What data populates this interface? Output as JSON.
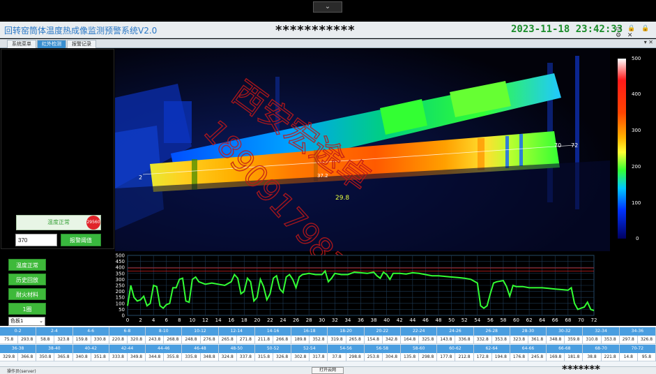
{
  "window": {
    "collapse_glyph": "⌄",
    "title": "回转窑筒体温度热成像监测预警系统V2.0",
    "masked_center": "***********",
    "clock": "2023-11-18 23:42:33",
    "window_icons": "▭ 🔒 🔒 ⚙ ✕"
  },
  "tabs": [
    {
      "label": "系统菜单",
      "active": false
    },
    {
      "label": "红外检测",
      "active": true
    },
    {
      "label": "报警记录",
      "active": false
    }
  ],
  "tab_pin": "▾ ✕",
  "status_panel": {
    "status_text": "温度正常",
    "alarm_badge": "29560",
    "threshold_value": "370",
    "threshold_button": "报警阈值"
  },
  "thermal": {
    "marker_start": "2",
    "marker_mid": "37.2",
    "marker_70": "70",
    "marker_72": "72",
    "spot_temp": "29.8",
    "watermark_name": "西安宏途卓",
    "watermark_phone": "18909179813"
  },
  "color_scale": {
    "labels": [
      "500",
      "400",
      "300",
      "200",
      "100",
      "0"
    ]
  },
  "side_buttons": [
    "温度正常",
    "历史回放",
    "耐火材料",
    "1圈"
  ],
  "palette_select": "色板1",
  "chart_data": {
    "type": "line",
    "ylabel": "温度",
    "ylim": [
      0,
      500
    ],
    "yticks": [
      0,
      50,
      100,
      150,
      200,
      250,
      300,
      350,
      400,
      450,
      500
    ],
    "xlim": [
      0,
      72
    ],
    "xticks": [
      0,
      2,
      4,
      6,
      8,
      10,
      12,
      14,
      16,
      18,
      20,
      22,
      24,
      26,
      28,
      30,
      32,
      34,
      36,
      38,
      40,
      42,
      44,
      46,
      48,
      50,
      52,
      54,
      56,
      58,
      60,
      62,
      64,
      66,
      68,
      70,
      72
    ],
    "threshold_lines": [
      395,
      370
    ],
    "series": [
      {
        "color": "#33ff33",
        "points": [
          [
            0,
            80
          ],
          [
            0.5,
            250
          ],
          [
            1,
            150
          ],
          [
            1.5,
            120
          ],
          [
            2,
            130
          ],
          [
            2.5,
            160
          ],
          [
            3,
            80
          ],
          [
            3.5,
            100
          ],
          [
            4,
            250
          ],
          [
            4.5,
            240
          ],
          [
            5,
            80
          ],
          [
            5.5,
            60
          ],
          [
            6,
            90
          ],
          [
            6.5,
            100
          ],
          [
            7,
            230
          ],
          [
            7.5,
            230
          ],
          [
            8,
            300
          ],
          [
            8.5,
            310
          ],
          [
            9,
            120
          ],
          [
            9.5,
            110
          ],
          [
            10,
            300
          ],
          [
            10.5,
            320
          ],
          [
            11,
            280
          ],
          [
            12,
            260
          ],
          [
            13,
            270
          ],
          [
            14,
            260
          ],
          [
            15,
            250
          ],
          [
            16,
            280
          ],
          [
            16.5,
            340
          ],
          [
            17,
            310
          ],
          [
            17.5,
            180
          ],
          [
            18,
            200
          ],
          [
            18.5,
            310
          ],
          [
            19,
            280
          ],
          [
            19.5,
            120
          ],
          [
            20,
            150
          ],
          [
            20.5,
            300
          ],
          [
            21,
            240
          ],
          [
            21.5,
            130
          ],
          [
            22,
            180
          ],
          [
            22.5,
            310
          ],
          [
            23,
            330
          ],
          [
            23.5,
            220
          ],
          [
            24,
            190
          ],
          [
            24.5,
            320
          ],
          [
            25,
            340
          ],
          [
            25.5,
            300
          ],
          [
            26,
            230
          ],
          [
            26.5,
            320
          ],
          [
            27,
            340
          ],
          [
            28,
            350
          ],
          [
            29,
            340
          ],
          [
            30,
            340
          ],
          [
            30.5,
            370
          ],
          [
            31,
            280
          ],
          [
            31.5,
            310
          ],
          [
            32,
            350
          ],
          [
            33,
            340
          ],
          [
            34,
            340
          ],
          [
            35,
            360
          ],
          [
            36,
            355
          ],
          [
            37,
            350
          ],
          [
            38,
            360
          ],
          [
            38.5,
            330
          ],
          [
            39,
            310
          ],
          [
            39.5,
            360
          ],
          [
            40,
            340
          ],
          [
            40.5,
            300
          ],
          [
            41,
            350
          ],
          [
            42,
            350
          ],
          [
            43,
            345
          ],
          [
            44,
            355
          ],
          [
            45,
            350
          ],
          [
            46,
            340
          ],
          [
            47,
            330
          ],
          [
            48,
            330
          ],
          [
            49,
            325
          ],
          [
            50,
            320
          ],
          [
            51,
            315
          ],
          [
            52,
            310
          ],
          [
            53,
            300
          ],
          [
            54,
            270
          ],
          [
            54.5,
            80
          ],
          [
            55,
            60
          ],
          [
            55.5,
            80
          ],
          [
            56,
            180
          ],
          [
            56.5,
            270
          ],
          [
            57,
            280
          ],
          [
            58,
            290
          ],
          [
            58.5,
            240
          ],
          [
            59,
            160
          ],
          [
            59.5,
            250
          ],
          [
            60,
            240
          ],
          [
            61,
            240
          ],
          [
            62,
            230
          ],
          [
            63,
            230
          ],
          [
            64,
            230
          ],
          [
            65,
            225
          ],
          [
            66,
            220
          ],
          [
            67,
            215
          ],
          [
            68,
            210
          ],
          [
            68.5,
            230
          ],
          [
            69,
            100
          ],
          [
            69.5,
            50
          ],
          [
            70,
            60
          ],
          [
            70.5,
            70
          ],
          [
            71,
            110
          ],
          [
            71.5,
            50
          ],
          [
            72,
            40
          ]
        ]
      }
    ]
  },
  "table": {
    "row1_headers": [
      "0-2",
      "2-4",
      "4-6",
      "6-8",
      "8-10",
      "10-12",
      "12-14",
      "14-16",
      "16-18",
      "18-20",
      "20-22",
      "22-24",
      "24-26",
      "26-28",
      "28-30",
      "30-32",
      "32-34",
      "34-36"
    ],
    "row1_values": [
      "75.8",
      "293.8",
      "58.8",
      "323.8",
      "159.8",
      "330.8",
      "220.8",
      "320.8",
      "243.8",
      "268.8",
      "248.8",
      "276.8",
      "265.8",
      "271.8",
      "211.8",
      "266.8",
      "189.8",
      "352.8",
      "319.8",
      "265.8",
      "154.8",
      "342.8",
      "164.8",
      "325.8",
      "143.8",
      "336.8",
      "332.8",
      "353.8",
      "323.8",
      "361.8",
      "348.8",
      "359.8",
      "310.8",
      "353.8",
      "297.8",
      "326.8"
    ],
    "row2_headers": [
      "36-38",
      "38-40",
      "40-42",
      "42-44",
      "44-46",
      "46-48",
      "48-50",
      "50-52",
      "52-54",
      "54-56",
      "56-58",
      "58-60",
      "60-62",
      "62-64",
      "64-66",
      "66-68",
      "68-70",
      "70-72"
    ],
    "row2_values": [
      "329.8",
      "366.8",
      "350.8",
      "365.8",
      "340.8",
      "351.8",
      "333.8",
      "349.8",
      "344.8",
      "355.8",
      "335.8",
      "348.8",
      "324.8",
      "337.8",
      "315.8",
      "326.8",
      "302.8",
      "317.8",
      "37.8",
      "298.8",
      "253.8",
      "304.8",
      "135.8",
      "298.8",
      "177.8",
      "212.8",
      "172.8",
      "194.8",
      "176.8",
      "245.8",
      "169.8",
      "181.8",
      "38.8",
      "221.8",
      "14.8",
      "95.8"
    ]
  },
  "statusbar": {
    "user": "操作员(server)",
    "open_preview": "打开云网",
    "masked_footer": "*******"
  }
}
